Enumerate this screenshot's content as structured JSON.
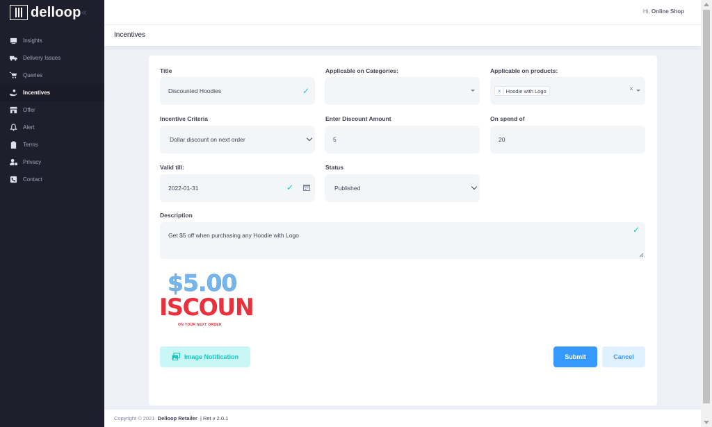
{
  "app": {
    "logo_text": "delloop"
  },
  "header": {
    "greeting_prefix": "Hi,",
    "user_name": "Online Shop"
  },
  "page": {
    "title": "Incentives"
  },
  "sidebar": {
    "items": [
      {
        "label": "Insights",
        "icon": "insights-icon",
        "active": false
      },
      {
        "label": "Delivery Issues",
        "icon": "truck-icon",
        "active": false
      },
      {
        "label": "Queries",
        "icon": "cart-icon",
        "active": false
      },
      {
        "label": "Incentives",
        "icon": "hand-coin-icon",
        "active": true
      },
      {
        "label": "Offer",
        "icon": "store-icon",
        "active": false
      },
      {
        "label": "Alert",
        "icon": "bell-icon",
        "active": false
      },
      {
        "label": "Terms",
        "icon": "clipboard-icon",
        "active": false
      },
      {
        "label": "Privacy",
        "icon": "user-lock-icon",
        "active": false
      },
      {
        "label": "Contact",
        "icon": "phone-icon",
        "active": false
      }
    ]
  },
  "form": {
    "title": {
      "label": "Title",
      "value": "Discounted Hoodies"
    },
    "categories": {
      "label": "Applicable on Categories:",
      "value": ""
    },
    "products": {
      "label": "Applicable on products:",
      "tags": [
        "Hoodie with Logo"
      ]
    },
    "criteria": {
      "label": "Incentive Criteria",
      "value": "Dollar discount on next order"
    },
    "discount": {
      "label": "Enter Discount Amount",
      "value": "5"
    },
    "spend": {
      "label": "On spend of",
      "value": "20"
    },
    "valid_till": {
      "label": "Valid till:",
      "value": "2022-01-31"
    },
    "status": {
      "label": "Status",
      "value": "Published"
    },
    "description": {
      "label": "Description",
      "value": "Get $5 off when purchasing any Hoodie with Logo"
    }
  },
  "promo_image": {
    "amount": "$5.00",
    "headline": "ISCOUN",
    "subtext": "ON YOUR NEXT ORDER"
  },
  "buttons": {
    "image_notification": "Image Notification",
    "submit": "Submit",
    "cancel": "Cancel"
  },
  "footer": {
    "copyright": "Copyright © 2021",
    "company": "Delloop Retailer",
    "version": "| Ret v 2.0.1"
  },
  "colors": {
    "accent": "#3699ff",
    "success": "#1bc5bd",
    "sidebar_bg": "#1e1e2d"
  }
}
